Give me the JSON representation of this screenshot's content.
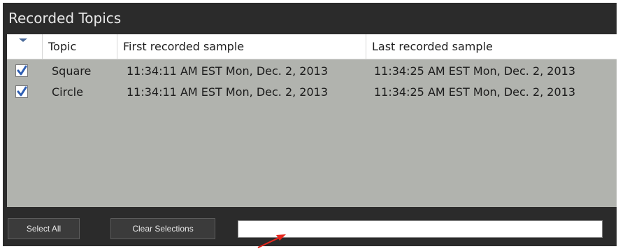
{
  "panel": {
    "title": "Recorded Topics"
  },
  "table": {
    "columns": [
      "",
      "Topic",
      "First recorded sample",
      "Last recorded sample"
    ],
    "rows": [
      {
        "checked": true,
        "topic": "Square",
        "first": "11:34:11 AM EST  Mon, Dec. 2, 2013",
        "last": "11:34:25 AM EST  Mon, Dec. 2, 2013"
      },
      {
        "checked": true,
        "topic": "Circle",
        "first": "11:34:11 AM EST  Mon, Dec. 2, 2013",
        "last": "11:34:25 AM EST  Mon, Dec. 2, 2013"
      }
    ]
  },
  "buttons": {
    "select_all": "Select All",
    "clear_selections": "Clear Selections"
  },
  "filter": {
    "value": "",
    "placeholder": ""
  },
  "colors": {
    "panel_bg": "#2b2b2b",
    "table_bg": "#b1b3ae",
    "checkmark": "#2f5fb3",
    "annotation_arrow": "#e8281e"
  }
}
